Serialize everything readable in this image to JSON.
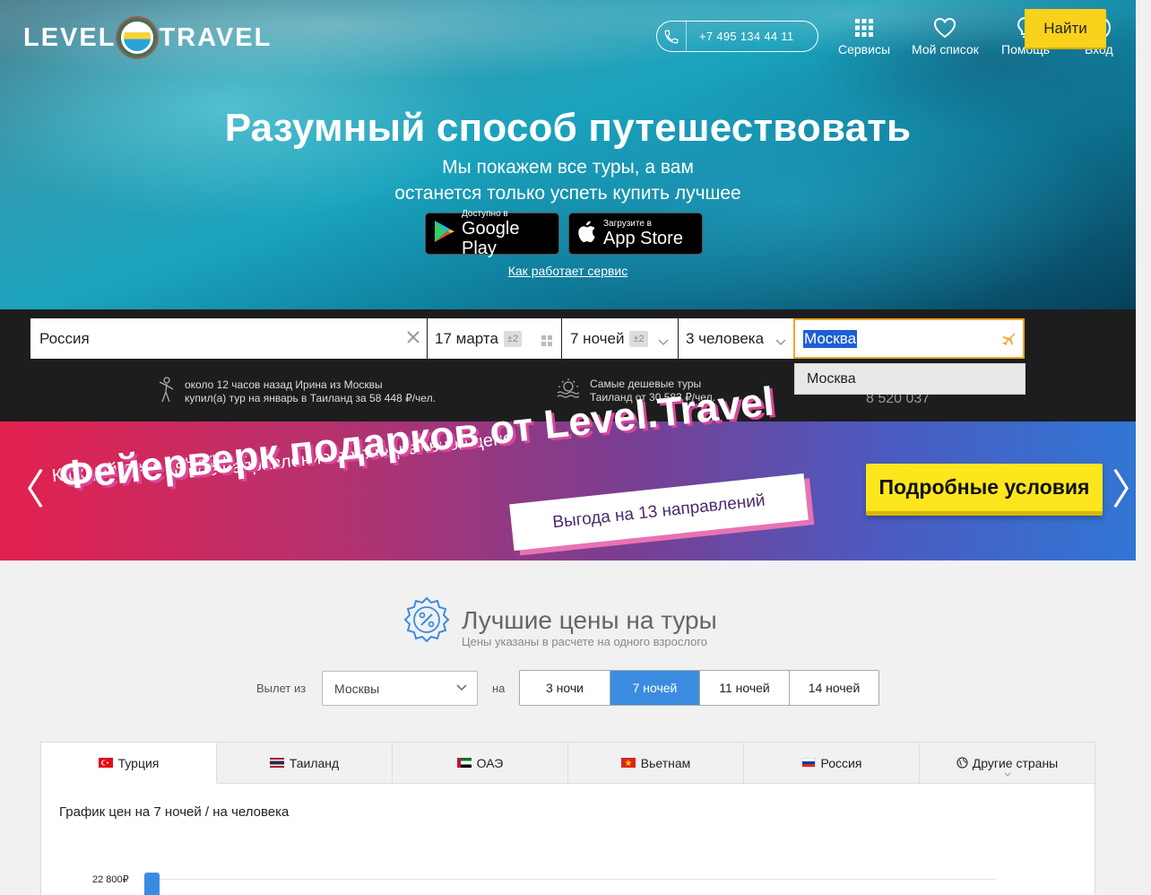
{
  "header": {
    "logo_left": "LEVEL",
    "logo_right": "TRAVEL",
    "phone": "+7 495 134 44 11",
    "nav": [
      {
        "label": "Сервисы",
        "icon": "grid-icon"
      },
      {
        "label": "Мой список",
        "icon": "heart-icon"
      },
      {
        "label": "Помощь",
        "icon": "bulb-icon"
      },
      {
        "label": "Вход",
        "icon": "user-icon"
      }
    ]
  },
  "hero": {
    "title": "Разумный способ путешествовать",
    "subtitle_line1": "Мы покажем все туры, а вам",
    "subtitle_line2": "останется только успеть купить лучшее",
    "google_play_small": "Доступно в",
    "google_play_large": "Google Play",
    "app_store_small": "Загрузите в",
    "app_store_large": "App Store",
    "how_link": "Как работает сервис"
  },
  "search": {
    "destination": "Россия",
    "date": "17 марта",
    "date_flex": "±2",
    "nights": "7 ночей",
    "nights_flex": "±2",
    "people": "3 человека",
    "departure": "Москва",
    "find_button": "Найти",
    "dropdown_option": "Москва",
    "info_left_line1": "около 12 часов назад Ирина из Москвы",
    "info_left_line2": "купил(а) тур на январь в Таиланд за 58 448 ₽/чел.",
    "info_mid_line1": "Самые дешевые туры",
    "info_mid_line2": "Таиланд от 30 583 ₽/чел.",
    "counter": "8 520 037"
  },
  "banner": {
    "small_line1": "Каждый день каникул –",
    "small_line2": "новое направление по специальной цене",
    "big": "Фейерверк подарков от Level.Travel",
    "ribbon": "Выгода на 13 направлений",
    "cta": "Подробные условия",
    "prev_arrow": "〈",
    "next_arrow": "〉"
  },
  "best_prices": {
    "title": "Лучшие цены на туры",
    "subtitle": "Цены указаны в расчете на одного взрослого",
    "from_label": "Вылет из",
    "from_value": "Москвы",
    "to_label": "на",
    "nights_options": [
      "3 ночи",
      "7 ночей",
      "11 ночей",
      "14 ночей"
    ],
    "nights_selected": "7 ночей",
    "tabs": [
      {
        "label": "Турция",
        "flag": "turkey"
      },
      {
        "label": "Таиланд",
        "flag": "thailand"
      },
      {
        "label": "ОАЭ",
        "flag": "uae"
      },
      {
        "label": "Вьетнам",
        "flag": "vietnam"
      },
      {
        "label": "Россия",
        "flag": "russia"
      },
      {
        "label": "Другие страны",
        "flag": "globe"
      }
    ],
    "active_tab": "Турция",
    "chart_title": "График цен на 7 ночей / на человека"
  },
  "chart_data": {
    "type": "bar",
    "title": "График цен на 7 ночей / на человека",
    "y_ticks": [
      "22 800₽"
    ],
    "values_visible": [
      22800
    ]
  },
  "colors": {
    "accent_blue": "#3b8ce0",
    "find_yellow": "#f9d21b",
    "search_dark": "#1d1d1d"
  }
}
